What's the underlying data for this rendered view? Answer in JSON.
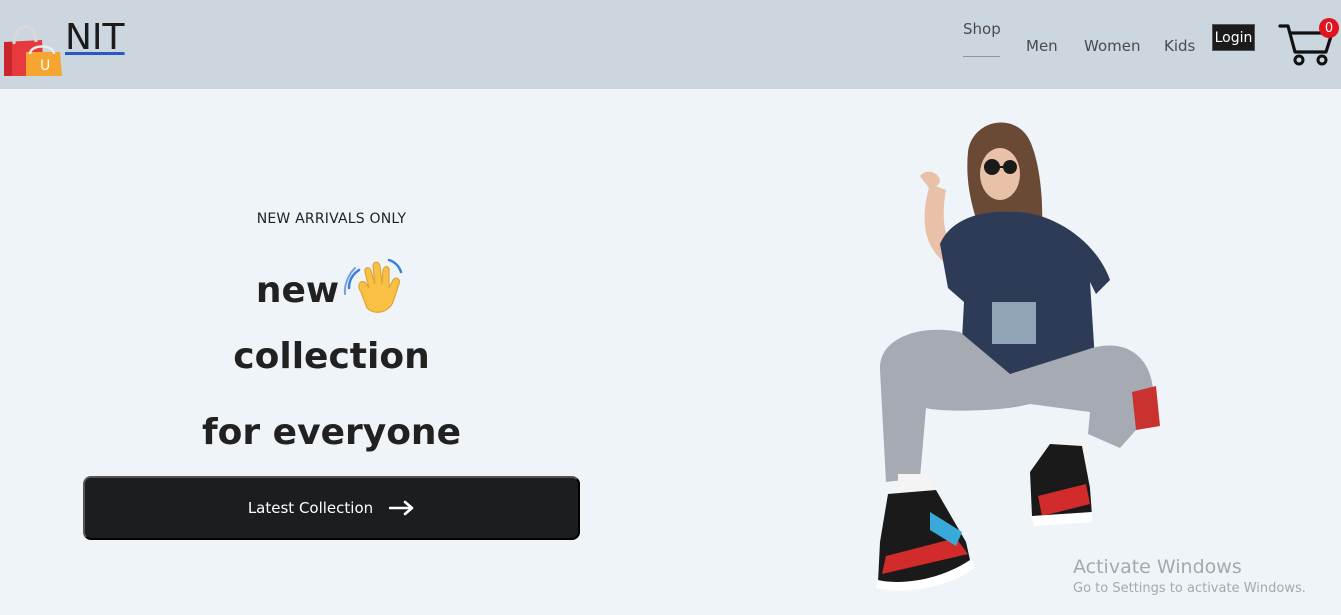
{
  "header": {
    "brand": "NIT",
    "logo_letter": "U",
    "nav": {
      "shop": "Shop",
      "men": "Men",
      "women": "Women",
      "kids": "Kids"
    },
    "login_label": "Login",
    "cart_count": "0"
  },
  "hero": {
    "eyebrow": "NEW ARRIVALS ONLY",
    "line1": "new",
    "line2": "collection",
    "line3": "for everyone",
    "cta_label": "Latest Collection",
    "cta_icon": "arrow-right-icon",
    "wave_icon": "waving-hand-icon"
  },
  "watermark": {
    "title": "Activate Windows",
    "subtitle": "Go to Settings to activate Windows."
  },
  "colors": {
    "navbar_bg": "#cbd6df",
    "page_bg": "#eff4f9",
    "cta_bg": "#1c1d1f",
    "badge_red": "#e0141e",
    "brand_underline": "#2a57c6"
  }
}
